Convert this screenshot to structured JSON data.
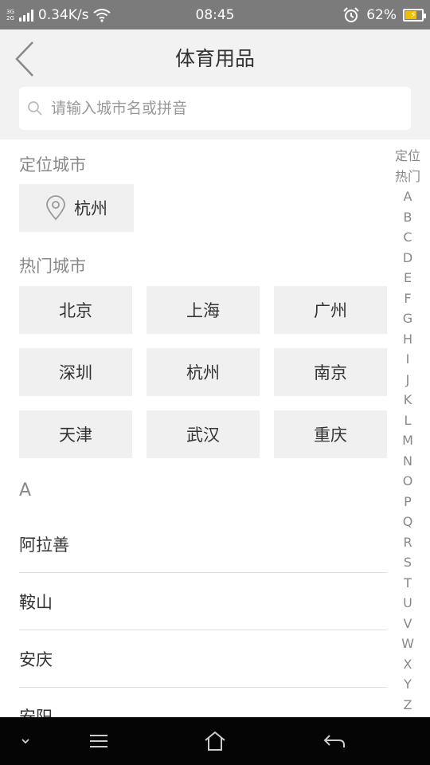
{
  "status_bar": {
    "net_top": "3G",
    "net_bottom": "2G",
    "speed": "0.34K/s",
    "time": "08:45",
    "battery": "62%",
    "battery_level": 0.62
  },
  "header": {
    "title": "体育用品"
  },
  "search": {
    "placeholder": "请输入城市名或拼音"
  },
  "location": {
    "title": "定位城市",
    "city": "杭州"
  },
  "hot": {
    "title": "热门城市",
    "cities": [
      "北京",
      "上海",
      "广州",
      "深圳",
      "杭州",
      "南京",
      "天津",
      "武汉",
      "重庆"
    ]
  },
  "list": {
    "letter": "A",
    "cities": [
      "阿拉善",
      "鞍山",
      "安庆",
      "安阳"
    ]
  },
  "index": [
    "定位",
    "热门",
    "A",
    "B",
    "C",
    "D",
    "E",
    "F",
    "G",
    "H",
    "I",
    "J",
    "K",
    "L",
    "M",
    "N",
    "O",
    "P",
    "Q",
    "R",
    "S",
    "T",
    "U",
    "V",
    "W",
    "X",
    "Y",
    "Z"
  ]
}
